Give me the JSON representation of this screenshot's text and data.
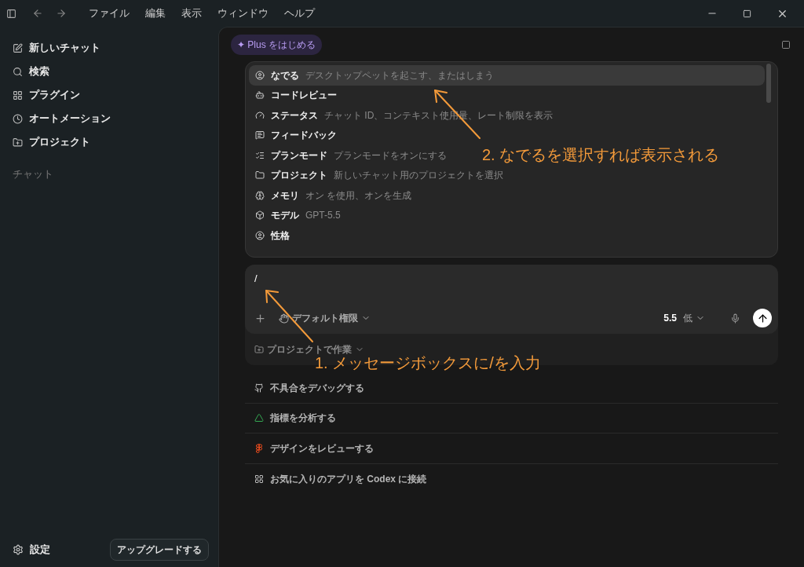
{
  "menu_bar": [
    "ファイル",
    "編集",
    "表示",
    "ウィンドウ",
    "ヘルプ"
  ],
  "sidebar": {
    "items": [
      {
        "label": "新しいチャット"
      },
      {
        "label": "検索"
      },
      {
        "label": "プラグイン"
      },
      {
        "label": "オートメーション"
      },
      {
        "label": "プロジェクト"
      }
    ],
    "section": "チャット",
    "settings": "設定",
    "upgrade": "アップグレードする"
  },
  "plus_badge": "✦ Plus をはじめる",
  "commands": [
    {
      "name": "なでる",
      "description": "デスクトップペットを起こす、またはしまう",
      "selected": true
    },
    {
      "name": "コードレビュー",
      "selected": false
    },
    {
      "name": "ステータス",
      "description": "チャット ID、コンテキスト使用量、レート制限を表示",
      "selected": false
    },
    {
      "name": "フィードバック",
      "selected": false
    },
    {
      "name": "プランモード",
      "description": "プランモードをオンにする",
      "selected": false
    },
    {
      "name": "プロジェクト",
      "description": "新しいチャット用のプロジェクトを選択",
      "selected": false
    },
    {
      "name": "メモリ",
      "description": "オン を使用、オンを生成",
      "selected": false
    },
    {
      "name": "モデル",
      "description": "GPT-5.5",
      "selected": false
    },
    {
      "name": "性格",
      "selected": false
    }
  ],
  "composer": {
    "value": "/",
    "permission": "デフォルト権限",
    "model": "5.5",
    "effort": "低",
    "project": "プロジェクトで作業"
  },
  "suggestions": [
    "不具合をデバッグする",
    "指標を分析する",
    "デザインをレビューする",
    "お気に入りのアプリを Codex に接続"
  ],
  "annotations": [
    {
      "text": "2. なでるを選択すれば表示される"
    },
    {
      "text": "1. メッセージボックスに/を入力"
    }
  ]
}
